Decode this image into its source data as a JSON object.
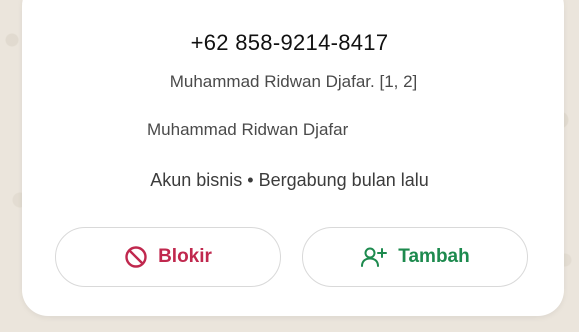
{
  "contact": {
    "phone": "+62 858-9214-8417",
    "push_name": "Muhammad Ridwan Djafar. [1, 2]",
    "about": "Muhammad Ridwan Djafar",
    "meta": "Akun bisnis • Bergabung bulan lalu"
  },
  "actions": {
    "block_label": "Blokir",
    "block_icon": "block-icon",
    "add_label": "Tambah",
    "add_icon": "add-person-icon"
  },
  "colors": {
    "block": "#c0284e",
    "add": "#1d8a4e"
  }
}
